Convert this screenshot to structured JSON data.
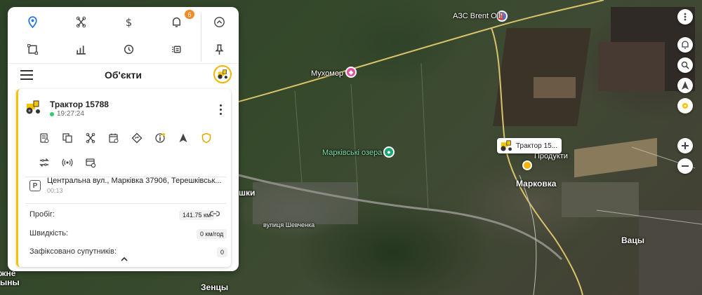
{
  "panel": {
    "toolbar": {
      "row1": [
        "location-pin-icon",
        "drone-icon",
        "dollar-icon",
        "bell-icon",
        "chevron-up-circle-icon"
      ],
      "row2": [
        "crop-icon",
        "bar-chart-icon",
        "clock-history-icon",
        "list-icon",
        "pin-icon"
      ],
      "notification_count": "6"
    },
    "header": {
      "title": "Об'єкти"
    },
    "card": {
      "name": "Трактор 15788",
      "time": "19:27:24",
      "actions_row1": [
        "report-icon",
        "copy-icon",
        "drone-icon",
        "calendar-icon",
        "diamond-icon",
        "info-icon",
        "navigation-icon",
        "shield-icon"
      ],
      "actions_row2": [
        "transfer-icon",
        "radio-icon",
        "card-settings-icon"
      ],
      "address": "Центральна вул., Марківка 37906, Терешківськ...",
      "address_duration": "00:13",
      "stats": [
        {
          "label": "Пробіг:",
          "value": "141.75 км"
        },
        {
          "label": "Швидкість:",
          "value": "0 км/год"
        },
        {
          "label": "Зафіксовано супутників:",
          "value": "0"
        }
      ]
    }
  },
  "map": {
    "labels": {
      "gas_station": "АЗС Brent Oil",
      "mushroom": "Мухомор",
      "lakes": "Марківські озера",
      "products": "Продукти",
      "markovka": "Марковка",
      "vatsy": "Вацы",
      "street": "вулиця Шевченка",
      "zentsy": "Зенцы",
      "shki": "шки",
      "left_zhne": "жне",
      "left_yny": "ыны"
    },
    "marker_label": "Трактор 15...",
    "accent_color": "#f5c400"
  }
}
